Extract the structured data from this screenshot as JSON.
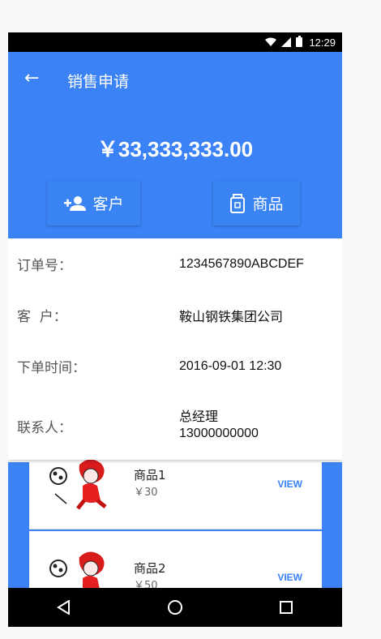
{
  "status_bar": {
    "time": "12:29",
    "icons": [
      "wifi-icon",
      "signal-icon",
      "battery-icon"
    ]
  },
  "header": {
    "title": "销售申请",
    "amount": "￥33,333,333.00",
    "buttons": {
      "customer_label": "客户",
      "goods_label": "商品"
    }
  },
  "info": {
    "rows": [
      {
        "label": "订单号：",
        "value": "1234567890ABCDEF"
      },
      {
        "label": "客  户：",
        "value": "鞍山钢铁集团公司"
      },
      {
        "label": "下单时间：",
        "value": "2016-09-01 12:30"
      },
      {
        "label": "联系人：",
        "value_line1": "总经理",
        "value_line2": "13000000000"
      }
    ]
  },
  "products": [
    {
      "name": "商品1",
      "price": "￥30",
      "action": "VIEW"
    },
    {
      "name": "商品2",
      "price": "￥50",
      "action": "VIEW"
    }
  ],
  "nav": [
    "back-nav-icon",
    "home-nav-icon",
    "recents-nav-icon"
  ],
  "colors": {
    "primary": "#3b82f6"
  }
}
